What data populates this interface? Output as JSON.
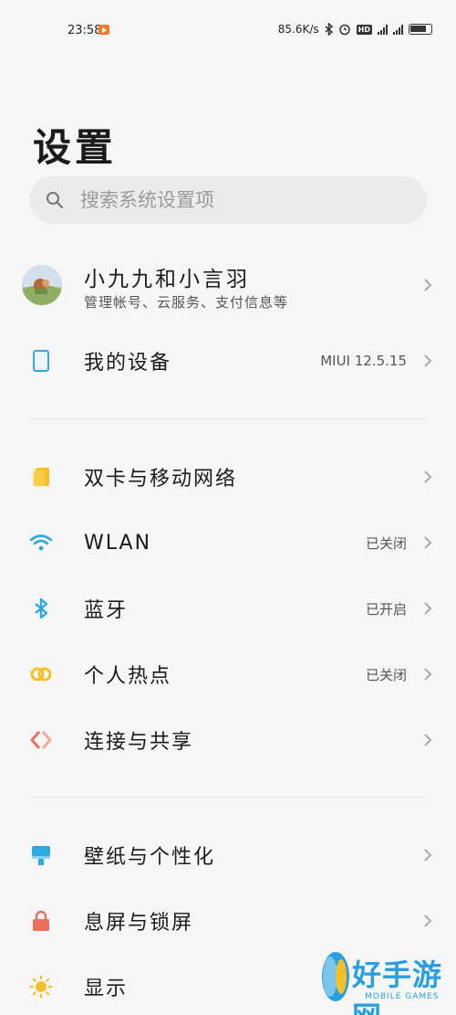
{
  "status_bar": {
    "time": "23:58",
    "net_speed": "85.6K/s",
    "icons": [
      "bluetooth-icon",
      "alarm-icon",
      "hd-icon",
      "signal-icon",
      "signal-icon",
      "battery-icon"
    ],
    "hd_label": "HD"
  },
  "page": {
    "title": "设置"
  },
  "search": {
    "placeholder": "搜索系统设置项",
    "icon": "search-icon"
  },
  "account": {
    "name": "小九九和小言羽",
    "subtitle": "管理帐号、云服务、支付信息等"
  },
  "groups": [
    {
      "items": [
        {
          "label": "我的设备",
          "value": "MIUI 12.5.15",
          "icon": "device-icon",
          "color": "#3aa6dd"
        }
      ]
    },
    {
      "items": [
        {
          "label": "双卡与移动网络",
          "value": "",
          "icon": "sim-card-icon",
          "color": "#f4c02a"
        },
        {
          "label": "WLAN",
          "value": "已关闭",
          "icon": "wifi-icon",
          "color": "#2ea9e0"
        },
        {
          "label": "蓝牙",
          "value": "已开启",
          "icon": "bluetooth-icon",
          "color": "#2ea9e0"
        },
        {
          "label": "个人热点",
          "value": "已关闭",
          "icon": "hotspot-icon",
          "color": "#f4c02a"
        },
        {
          "label": "连接与共享",
          "value": "",
          "icon": "connection-share-icon",
          "color": "#e9705a"
        }
      ]
    },
    {
      "items": [
        {
          "label": "壁纸与个性化",
          "value": "",
          "icon": "wallpaper-icon",
          "color": "#2ea9e0"
        },
        {
          "label": "息屏与锁屏",
          "value": "",
          "icon": "lock-icon",
          "color": "#e9705a"
        },
        {
          "label": "显示",
          "value": "",
          "icon": "brightness-icon",
          "color": "#f4c02a"
        }
      ]
    }
  ],
  "watermark": {
    "brand": "好手游网",
    "sub": "MOBILE GAMES"
  }
}
